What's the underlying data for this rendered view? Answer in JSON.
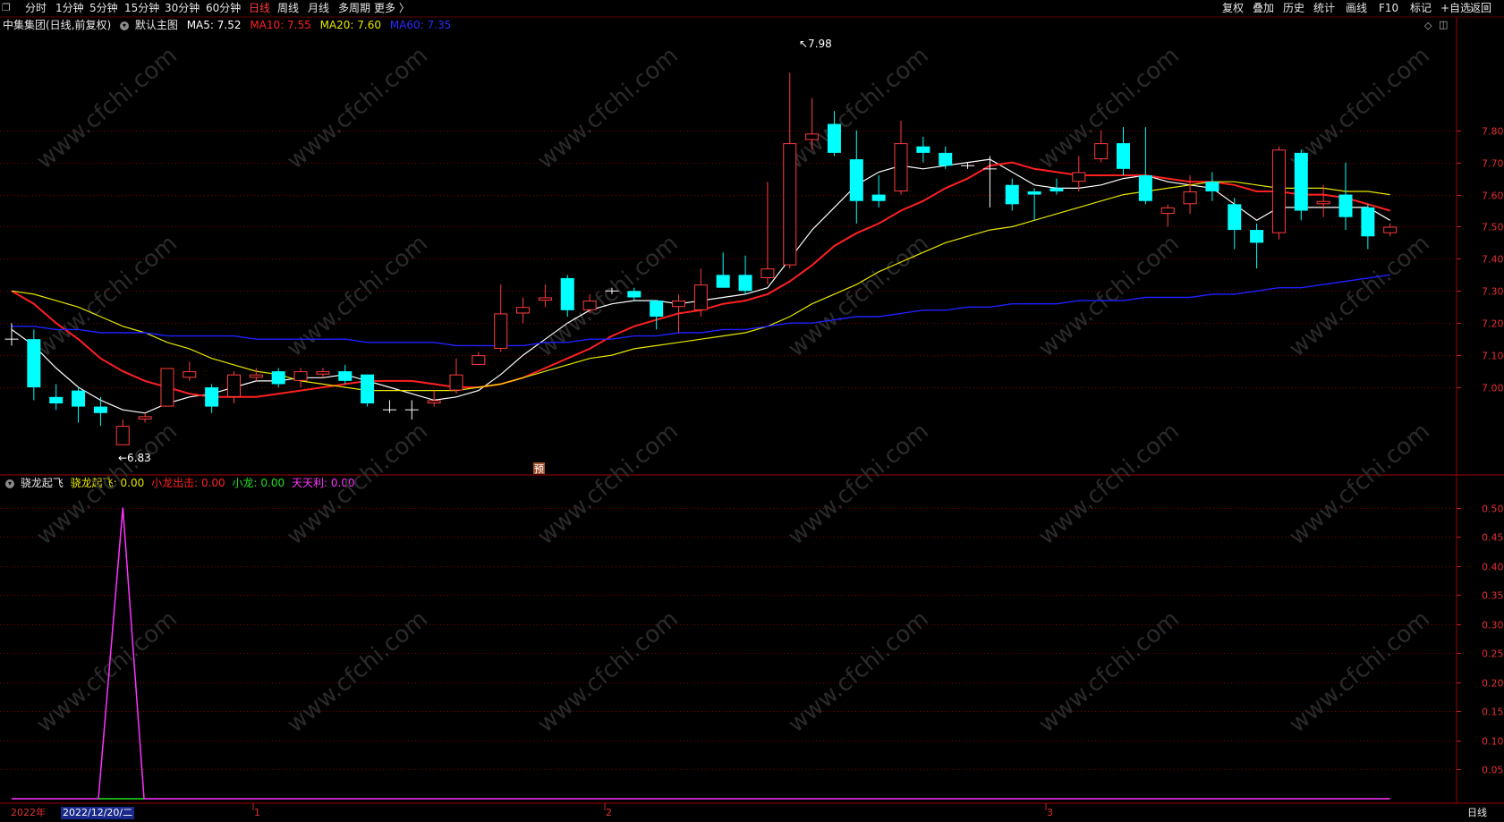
{
  "toolbar": {
    "left_items": [
      {
        "label": "分时",
        "active": false
      },
      {
        "label": "1分钟",
        "active": false
      },
      {
        "label": "5分钟",
        "active": false
      },
      {
        "label": "15分钟",
        "active": false
      },
      {
        "label": "30分钟",
        "active": false
      },
      {
        "label": "60分钟",
        "active": false
      },
      {
        "label": "日线",
        "active": true
      },
      {
        "label": "周线",
        "active": false
      },
      {
        "label": "月线",
        "active": false
      },
      {
        "label": "多周期",
        "active": false
      },
      {
        "label": "更多 〉",
        "active": false
      }
    ],
    "right_items": [
      "复权",
      "叠加",
      "历史",
      "统计",
      "画线",
      "F10",
      "标记",
      "+自选",
      "返回"
    ]
  },
  "main_info": {
    "stock_title": "中集集团(日线,前复权)",
    "template": "默认主图",
    "ma5": {
      "label": "MA5:",
      "value": "7.52",
      "color": "#ffffff"
    },
    "ma10": {
      "label": "MA10:",
      "value": "7.55",
      "color": "#ff2020"
    },
    "ma20": {
      "label": "MA20:",
      "value": "7.60",
      "color": "#e6e600"
    },
    "ma60": {
      "label": "MA60:",
      "value": "7.35",
      "color": "#2020ff"
    }
  },
  "sub_info": {
    "indicator_name": "骁龙起飞",
    "items": [
      {
        "label": "骁龙起飞:",
        "value": "0.00",
        "color": "#e6e600"
      },
      {
        "label": "小龙出击:",
        "value": "0.00",
        "color": "#ff2020"
      },
      {
        "label": "小龙:",
        "value": "0.00",
        "color": "#20e020"
      },
      {
        "label": "天天利:",
        "value": "0.00",
        "color": "#ff33ff"
      }
    ]
  },
  "price_axis": {
    "ticks": [
      "7.80",
      "7.70",
      "7.60",
      "7.50",
      "7.40",
      "7.30",
      "7.20",
      "7.10",
      "7.00"
    ],
    "min": 6.73,
    "max": 8.1
  },
  "sub_axis": {
    "ticks": [
      "0.50",
      "0.45",
      "0.40",
      "0.35",
      "0.30",
      "0.25",
      "0.20",
      "0.15",
      "0.10",
      "0.05"
    ],
    "min": 0,
    "max": 0.53
  },
  "annotations": {
    "high_label": "7.98",
    "low_label": "6.83",
    "marker_label": "预"
  },
  "bottom_bar": {
    "year_label": "2022年",
    "cursor_date": "2022/12/20/二",
    "month_labels": [
      "1",
      "2",
      "3"
    ],
    "period_label": "日线"
  },
  "colors": {
    "up": "#ff3c3c",
    "down": "#00ffff",
    "grid": "#7a0000",
    "axis_text": "#e03030"
  },
  "chart_data": [
    {
      "type": "candlestick",
      "series": [
        {
          "name": "K",
          "ohlc": [
            [
              7.15,
              7.15,
              7.13,
              7.2
            ],
            [
              7.15,
              7.0,
              6.96,
              7.18
            ],
            [
              6.97,
              6.95,
              6.93,
              7.01
            ],
            [
              6.99,
              6.94,
              6.89,
              7.0
            ],
            [
              6.94,
              6.92,
              6.88,
              6.97
            ],
            [
              6.82,
              6.88,
              6.82,
              6.9
            ],
            [
              6.9,
              6.91,
              6.89,
              6.92
            ],
            [
              6.94,
              7.06,
              6.94,
              7.06
            ],
            [
              7.03,
              7.05,
              7.02,
              7.08
            ],
            [
              7.0,
              6.94,
              6.92,
              7.01
            ],
            [
              6.97,
              7.04,
              6.95,
              7.05
            ],
            [
              7.03,
              7.04,
              7.02,
              7.06
            ],
            [
              7.05,
              7.01,
              7.0,
              7.06
            ],
            [
              7.02,
              7.05,
              7.0,
              7.06
            ],
            [
              7.04,
              7.05,
              7.03,
              7.06
            ],
            [
              7.05,
              7.02,
              7.01,
              7.07
            ],
            [
              7.04,
              6.95,
              6.94,
              7.04
            ],
            [
              6.93,
              6.93,
              6.92,
              6.96
            ],
            [
              6.93,
              6.93,
              6.9,
              6.96
            ],
            [
              6.95,
              6.96,
              6.94,
              6.99
            ],
            [
              6.99,
              7.04,
              6.98,
              7.09
            ],
            [
              7.07,
              7.1,
              7.07,
              7.11
            ],
            [
              7.12,
              7.23,
              7.11,
              7.32
            ],
            [
              7.23,
              7.25,
              7.2,
              7.28
            ],
            [
              7.27,
              7.28,
              7.25,
              7.32
            ],
            [
              7.34,
              7.24,
              7.22,
              7.35
            ],
            [
              7.24,
              7.27,
              7.23,
              7.29
            ],
            [
              7.3,
              7.3,
              7.29,
              7.31
            ],
            [
              7.3,
              7.28,
              7.27,
              7.31
            ],
            [
              7.27,
              7.22,
              7.18,
              7.27
            ],
            [
              7.25,
              7.27,
              7.17,
              7.29
            ],
            [
              7.24,
              7.32,
              7.22,
              7.37
            ],
            [
              7.35,
              7.31,
              7.31,
              7.42
            ],
            [
              7.35,
              7.3,
              7.29,
              7.41
            ],
            [
              7.34,
              7.37,
              7.32,
              7.64
            ],
            [
              7.38,
              7.76,
              7.37,
              7.98
            ],
            [
              7.77,
              7.79,
              7.74,
              7.9
            ],
            [
              7.82,
              7.73,
              7.72,
              7.86
            ],
            [
              7.71,
              7.58,
              7.51,
              7.8
            ],
            [
              7.6,
              7.58,
              7.56,
              7.66
            ],
            [
              7.61,
              7.76,
              7.6,
              7.83
            ],
            [
              7.75,
              7.73,
              7.7,
              7.78
            ],
            [
              7.73,
              7.69,
              7.68,
              7.75
            ],
            [
              7.69,
              7.69,
              7.68,
              7.7
            ],
            [
              7.68,
              7.68,
              7.56,
              7.72
            ],
            [
              7.63,
              7.57,
              7.55,
              7.65
            ],
            [
              7.61,
              7.6,
              7.52,
              7.62
            ],
            [
              7.62,
              7.61,
              7.6,
              7.65
            ],
            [
              7.64,
              7.67,
              7.61,
              7.72
            ],
            [
              7.71,
              7.76,
              7.7,
              7.8
            ],
            [
              7.76,
              7.68,
              7.66,
              7.81
            ],
            [
              7.66,
              7.58,
              7.57,
              7.81
            ],
            [
              7.54,
              7.56,
              7.5,
              7.57
            ],
            [
              7.57,
              7.61,
              7.54,
              7.66
            ],
            [
              7.64,
              7.61,
              7.58,
              7.67
            ],
            [
              7.57,
              7.49,
              7.43,
              7.59
            ],
            [
              7.49,
              7.45,
              7.37,
              7.51
            ],
            [
              7.48,
              7.74,
              7.46,
              7.75
            ],
            [
              7.73,
              7.55,
              7.52,
              7.74
            ],
            [
              7.57,
              7.58,
              7.53,
              7.63
            ],
            [
              7.6,
              7.53,
              7.49,
              7.7
            ],
            [
              7.56,
              7.47,
              7.43,
              7.57
            ],
            [
              7.48,
              7.5,
              7.47,
              7.51
            ]
          ]
        }
      ]
    },
    {
      "type": "line",
      "series": [
        {
          "name": "MA5",
          "color": "#ffffff",
          "values": [
            7.18,
            7.13,
            7.06,
            7.0,
            6.96,
            6.93,
            6.92,
            6.95,
            6.97,
            6.98,
            7.0,
            7.02,
            7.02,
            7.03,
            7.03,
            7.04,
            7.02,
            7.0,
            6.98,
            6.96,
            6.97,
            6.99,
            7.04,
            7.1,
            7.15,
            7.2,
            7.24,
            7.26,
            7.27,
            7.27,
            7.26,
            7.27,
            7.28,
            7.29,
            7.31,
            7.4,
            7.49,
            7.56,
            7.63,
            7.67,
            7.69,
            7.68,
            7.69,
            7.7,
            7.71,
            7.67,
            7.63,
            7.62,
            7.62,
            7.63,
            7.65,
            7.66,
            7.64,
            7.63,
            7.62,
            7.57,
            7.52,
            7.56,
            7.56,
            7.56,
            7.56,
            7.56,
            7.52
          ]
        },
        {
          "name": "MA10",
          "color": "#ff2020",
          "values": [
            7.3,
            7.26,
            7.2,
            7.15,
            7.09,
            7.05,
            7.02,
            7.0,
            6.98,
            6.97,
            6.97,
            6.97,
            6.98,
            6.99,
            7.0,
            7.01,
            7.02,
            7.02,
            7.02,
            7.01,
            7.0,
            7.0,
            7.01,
            7.03,
            7.06,
            7.09,
            7.12,
            7.16,
            7.19,
            7.21,
            7.23,
            7.24,
            7.26,
            7.27,
            7.29,
            7.33,
            7.38,
            7.44,
            7.48,
            7.51,
            7.55,
            7.58,
            7.62,
            7.65,
            7.69,
            7.7,
            7.68,
            7.67,
            7.66,
            7.66,
            7.66,
            7.66,
            7.65,
            7.64,
            7.64,
            7.63,
            7.61,
            7.61,
            7.6,
            7.6,
            7.59,
            7.57,
            7.55
          ]
        },
        {
          "name": "MA20",
          "color": "#e6e600",
          "values": [
            7.3,
            7.29,
            7.27,
            7.25,
            7.22,
            7.19,
            7.17,
            7.14,
            7.12,
            7.09,
            7.07,
            7.05,
            7.04,
            7.02,
            7.01,
            7.0,
            6.99,
            6.99,
            6.99,
            6.99,
            6.99,
            7.0,
            7.01,
            7.03,
            7.05,
            7.07,
            7.09,
            7.1,
            7.12,
            7.13,
            7.14,
            7.15,
            7.16,
            7.17,
            7.19,
            7.22,
            7.26,
            7.29,
            7.32,
            7.36,
            7.39,
            7.42,
            7.45,
            7.47,
            7.49,
            7.5,
            7.52,
            7.54,
            7.56,
            7.58,
            7.6,
            7.61,
            7.62,
            7.63,
            7.64,
            7.64,
            7.63,
            7.62,
            7.62,
            7.62,
            7.61,
            7.61,
            7.6
          ]
        },
        {
          "name": "MA60",
          "color": "#2020ff",
          "values": [
            7.19,
            7.19,
            7.18,
            7.18,
            7.17,
            7.17,
            7.17,
            7.16,
            7.16,
            7.16,
            7.16,
            7.15,
            7.15,
            7.15,
            7.15,
            7.15,
            7.14,
            7.14,
            7.14,
            7.14,
            7.13,
            7.13,
            7.13,
            7.13,
            7.14,
            7.14,
            7.15,
            7.15,
            7.16,
            7.16,
            7.17,
            7.17,
            7.18,
            7.18,
            7.19,
            7.2,
            7.2,
            7.21,
            7.22,
            7.22,
            7.23,
            7.24,
            7.24,
            7.25,
            7.25,
            7.26,
            7.26,
            7.26,
            7.27,
            7.27,
            7.27,
            7.28,
            7.28,
            7.28,
            7.29,
            7.29,
            7.3,
            7.31,
            7.31,
            7.32,
            7.33,
            7.34,
            7.35
          ]
        }
      ]
    },
    {
      "type": "line",
      "series": [
        {
          "name": "天天利",
          "color": "#ff33ff",
          "values": [
            0,
            0,
            0,
            0,
            0,
            0.5,
            0,
            0,
            0,
            0,
            0,
            0,
            0,
            0,
            0,
            0,
            0,
            0,
            0,
            0,
            0,
            0,
            0,
            0,
            0,
            0,
            0,
            0,
            0,
            0,
            0,
            0,
            0,
            0,
            0,
            0,
            0,
            0,
            0,
            0,
            0,
            0,
            0,
            0,
            0,
            0,
            0,
            0,
            0,
            0,
            0,
            0,
            0,
            0,
            0,
            0,
            0,
            0,
            0,
            0,
            0,
            0,
            0
          ]
        }
      ]
    }
  ]
}
